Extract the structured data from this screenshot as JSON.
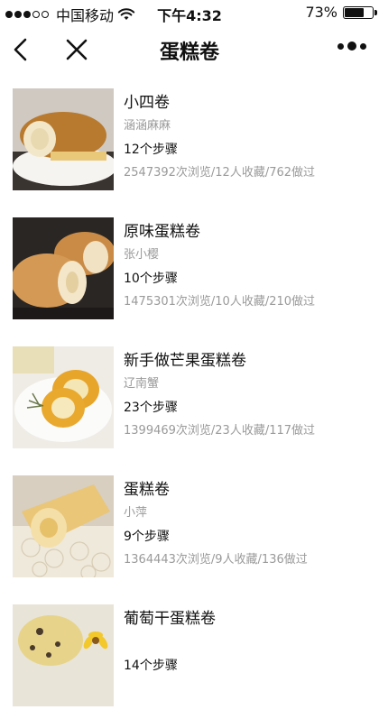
{
  "status_bar": {
    "carrier": "中国移动",
    "time": "下午4:32",
    "battery_percent": "73%",
    "battery_level": 0.73,
    "signal_bars_filled": 3,
    "signal_bars_total": 5
  },
  "nav": {
    "title": "蛋糕卷",
    "back_icon": "chevron-left-icon",
    "close_icon": "close-icon",
    "more_icon": "more-dots-icon"
  },
  "recipes": [
    {
      "title": "小四卷",
      "author": "涵涵麻麻",
      "steps": "12个步骤",
      "stats": "2547392次浏览/12人收藏/762做过"
    },
    {
      "title": "原味蛋糕卷",
      "author": "张小樱",
      "steps": "10个步骤",
      "stats": "1475301次浏览/10人收藏/210做过"
    },
    {
      "title": "新手做芒果蛋糕卷",
      "author": "辽南蟹",
      "steps": "23个步骤",
      "stats": "1399469次浏览/23人收藏/117做过"
    },
    {
      "title": "蛋糕卷",
      "author": "小萍",
      "steps": "9个步骤",
      "stats": "1364443次浏览/9人收藏/136做过"
    },
    {
      "title": "葡萄干蛋糕卷",
      "author": "",
      "steps": "14个步骤",
      "stats": ""
    }
  ],
  "colors": {
    "text_primary": "#111111",
    "text_secondary": "#9a9a9a",
    "background": "#ffffff"
  }
}
